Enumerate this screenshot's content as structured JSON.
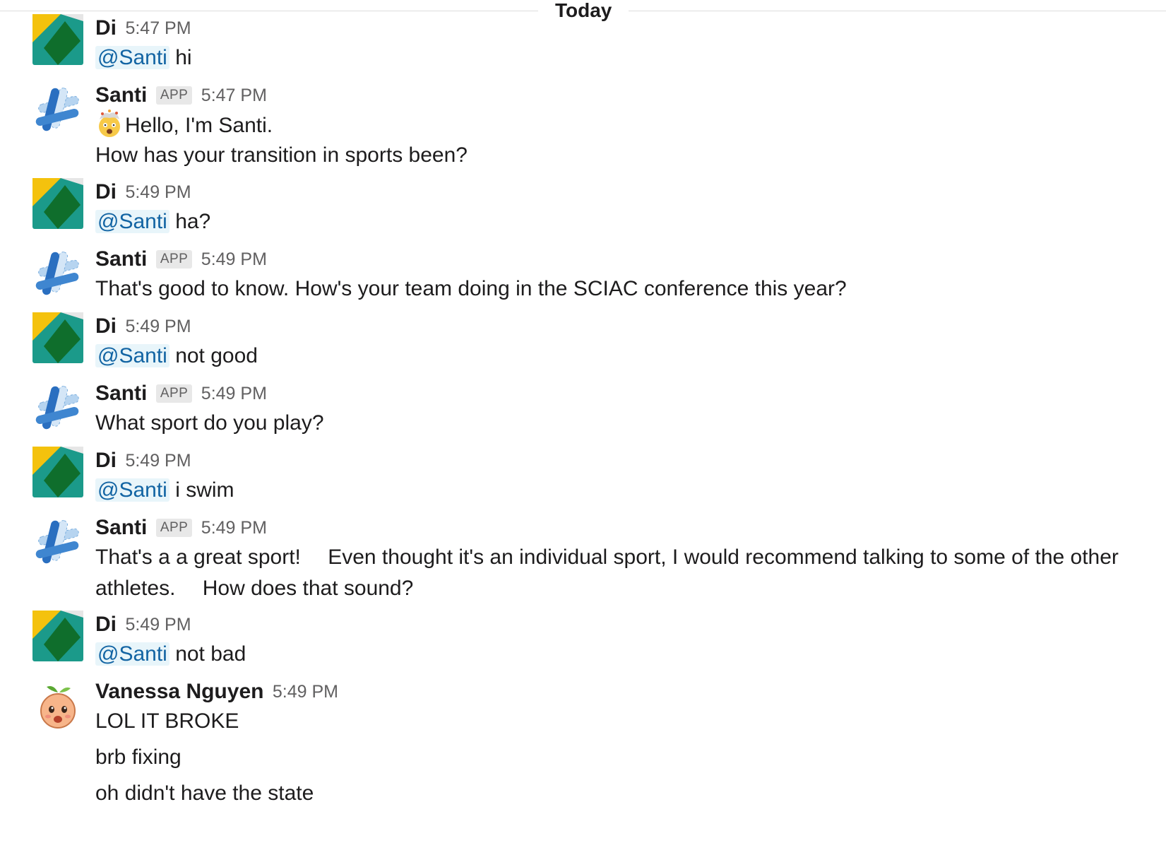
{
  "divider": {
    "label": "Today"
  },
  "mention_label": "@Santi",
  "app_badge": "APP",
  "colors": {
    "mention_text": "#1264a3",
    "mention_bg": "#e8f5fa",
    "timestamp": "#616061"
  },
  "messages": [
    {
      "user": "Di",
      "time": "5:47 PM",
      "text": "hi"
    },
    {
      "user": "Santi",
      "time": "5:47 PM",
      "line1": "Hello, I'm Santi.",
      "line2": "How has your transition in sports been?",
      "emoji": "exploding-head-emoji"
    },
    {
      "user": "Di",
      "time": "5:49 PM",
      "text": "ha?"
    },
    {
      "user": "Santi",
      "time": "5:49 PM",
      "text": "That's good to know. How's your team doing in the SCIAC conference this year?"
    },
    {
      "user": "Di",
      "time": "5:49 PM",
      "text": "not good"
    },
    {
      "user": "Santi",
      "time": "5:49 PM",
      "text": "What sport do you play?"
    },
    {
      "user": "Di",
      "time": "5:49 PM",
      "text": "i swim"
    },
    {
      "user": "Santi",
      "time": "5:49 PM",
      "part1": "That's a a great sport!",
      "part2": "Even thought it's an individual sport, I would recommend talking to some of the other athletes.",
      "part3": "How does that sound?"
    },
    {
      "user": "Di",
      "time": "5:49 PM",
      "text": "not bad"
    },
    {
      "user": "Vanessa Nguyen",
      "time": "5:49 PM",
      "lines": [
        "LOL IT BROKE",
        "brb fixing",
        "oh didn't have the state"
      ]
    }
  ]
}
